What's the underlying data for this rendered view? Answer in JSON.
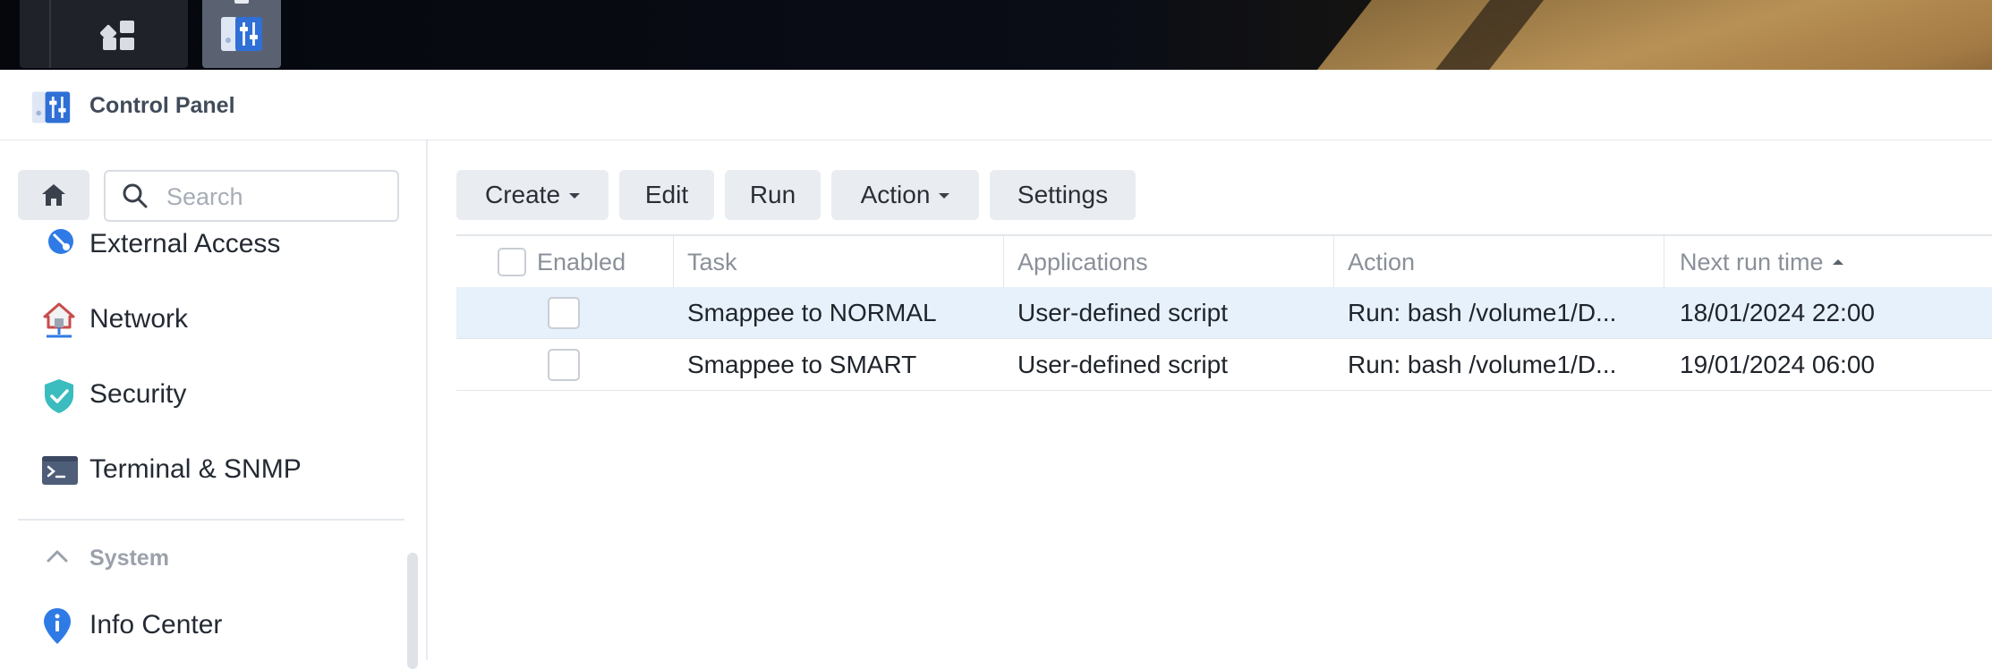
{
  "window": {
    "title": "Control Panel"
  },
  "taskbar": {
    "main_menu_icon": "grid-icon",
    "control_panel_icon": "control-panel-icon"
  },
  "sidebar": {
    "search_placeholder": "Search",
    "items": [
      {
        "label": "External Access",
        "icon": "external-access-icon"
      },
      {
        "label": "Network",
        "icon": "network-icon"
      },
      {
        "label": "Security",
        "icon": "shield-icon"
      },
      {
        "label": "Terminal & SNMP",
        "icon": "terminal-icon"
      }
    ],
    "section": {
      "label": "System",
      "expanded": true
    },
    "system_items": [
      {
        "label": "Info Center",
        "icon": "info-pin-icon"
      }
    ]
  },
  "toolbar": {
    "create_label": "Create",
    "edit_label": "Edit",
    "run_label": "Run",
    "action_label": "Action",
    "settings_label": "Settings"
  },
  "table": {
    "columns": [
      "Enabled",
      "Task",
      "Applications",
      "Action",
      "Next run time"
    ],
    "sort_column": "Next run time",
    "sort_direction": "ascending",
    "rows": [
      {
        "enabled": false,
        "task": "Smappee to NORMAL",
        "application": "User-defined script",
        "action": "Run: bash /volume1/D...",
        "next_run": "18/01/2024 22:00",
        "selected": true
      },
      {
        "enabled": false,
        "task": "Smappee to SMART",
        "application": "User-defined script",
        "action": "Run: bash /volume1/D...",
        "next_run": "19/01/2024 06:00",
        "selected": false
      }
    ]
  },
  "colors": {
    "selected_row": "#e7f1fb",
    "accent_blue": "#2f6fd6",
    "security_teal": "#3bbcbf"
  }
}
